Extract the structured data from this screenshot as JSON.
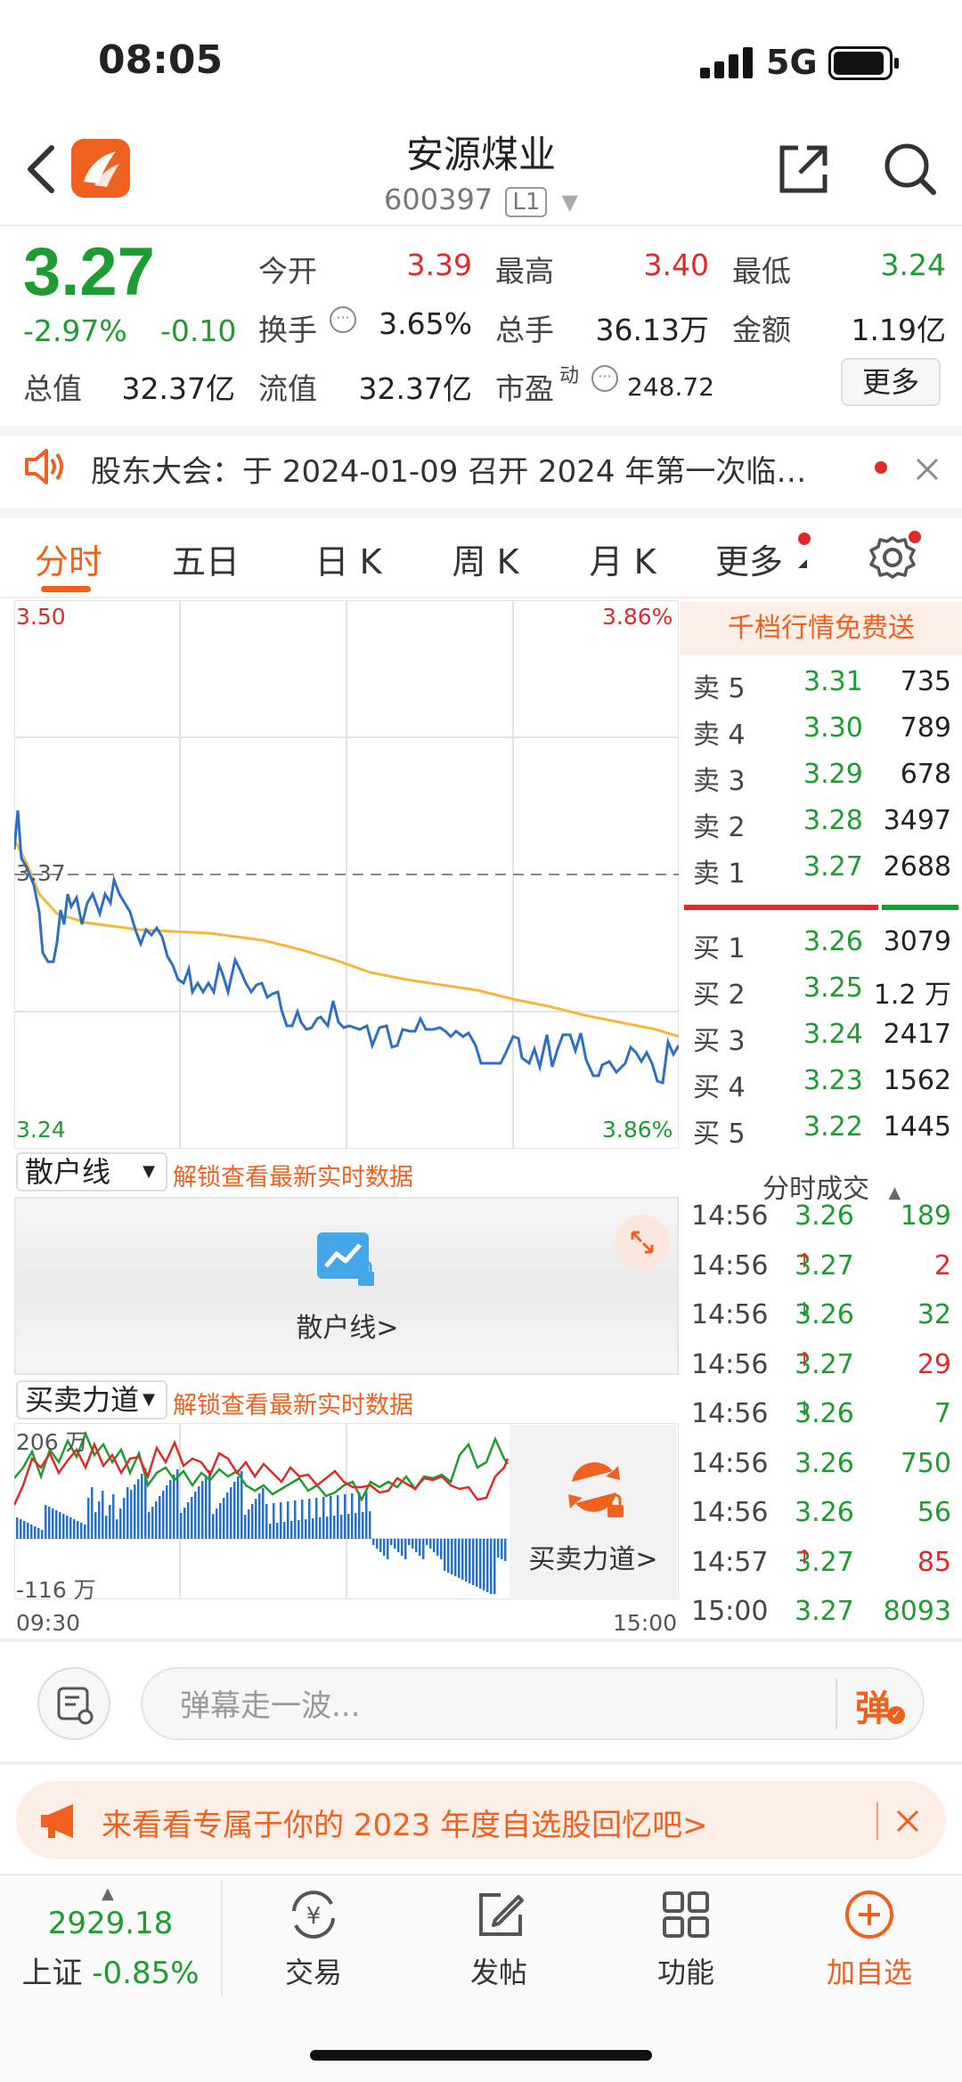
{
  "status_bar": {
    "time": "08:05",
    "network": "5G"
  },
  "header": {
    "name": "安源煤业",
    "code": "600397",
    "level": "L1"
  },
  "quote": {
    "price": "3.27",
    "change_pct": "-2.97%",
    "change": "-0.10",
    "open_label": "今开",
    "open": "3.39",
    "high_label": "最高",
    "high": "3.40",
    "low_label": "最低",
    "low": "3.24",
    "turnover_label": "换手",
    "turnover": "3.65%",
    "volume_label": "总手",
    "volume": "36.13万",
    "amount_label": "金额",
    "amount": "1.19亿",
    "mcap_label": "总值",
    "mcap": "32.37亿",
    "float_label": "流值",
    "float_cap": "32.37亿",
    "pe_label": "市盈",
    "pe_sup": "动",
    "pe": "248.72",
    "more": "更多"
  },
  "notice": {
    "text": "股东大会：于 2024-01-09 召开 2024 年第一次临…"
  },
  "tabs": [
    "分时",
    "五日",
    "日 K",
    "周 K",
    "月 K",
    "更多"
  ],
  "chart": {
    "top_price": "3.50",
    "top_pct": "3.86%",
    "bottom_price": "3.24",
    "bottom_pct": "3.86%",
    "ref_price": "3.37",
    "start_time": "09:30",
    "end_time": "15:00",
    "sub1_select": "散户线",
    "sub1_unlock": "解锁查看最新实时数据",
    "sub1_button": "散户线>",
    "sub2_select": "买卖力道",
    "sub2_unlock": "解锁查看最新实时数据",
    "sub2_button": "买卖力道>",
    "sub2_max": "206 万",
    "sub2_min": "-116 万"
  },
  "order_book": {
    "title": "千档行情免费送",
    "asks": [
      {
        "label": "卖 5",
        "price": "3.31",
        "vol": "735"
      },
      {
        "label": "卖 4",
        "price": "3.30",
        "vol": "789"
      },
      {
        "label": "卖 3",
        "price": "3.29",
        "vol": "678"
      },
      {
        "label": "卖 2",
        "price": "3.28",
        "vol": "3497"
      },
      {
        "label": "卖 1",
        "price": "3.27",
        "vol": "2688"
      }
    ],
    "bids": [
      {
        "label": "买 1",
        "price": "3.26",
        "vol": "3079"
      },
      {
        "label": "买 2",
        "price": "3.25",
        "vol": "1.2 万"
      },
      {
        "label": "买 3",
        "price": "3.24",
        "vol": "2417"
      },
      {
        "label": "买 4",
        "price": "3.23",
        "vol": "1562"
      },
      {
        "label": "买 5",
        "price": "3.22",
        "vol": "1445"
      }
    ]
  },
  "ticks": {
    "title": "分时成交",
    "rows": [
      {
        "time": "14:56",
        "price": "3.26",
        "arrow": "",
        "vol": "189",
        "color": "#1e9b31"
      },
      {
        "time": "14:56",
        "price": "3.27",
        "arrow": "↑",
        "vol": "2",
        "color": "#e02a2a"
      },
      {
        "time": "14:56",
        "price": "3.26",
        "arrow": "↓",
        "vol": "32",
        "color": "#1e9b31"
      },
      {
        "time": "14:56",
        "price": "3.27",
        "arrow": "↑",
        "vol": "29",
        "color": "#e02a2a"
      },
      {
        "time": "14:56",
        "price": "3.26",
        "arrow": "↓",
        "vol": "7",
        "color": "#1e9b31"
      },
      {
        "time": "14:56",
        "price": "3.26",
        "arrow": "",
        "vol": "750",
        "color": "#1e9b31"
      },
      {
        "time": "14:56",
        "price": "3.26",
        "arrow": "",
        "vol": "56",
        "color": "#1e9b31"
      },
      {
        "time": "14:57",
        "price": "3.27",
        "arrow": "↑",
        "vol": "85",
        "color": "#e02a2a"
      },
      {
        "time": "15:00",
        "price": "3.27",
        "arrow": "",
        "vol": "8093",
        "color": "#1e9b31"
      }
    ]
  },
  "danmu": {
    "placeholder": "弹幕走一波...",
    "button": "弹"
  },
  "promo": {
    "text": "来看看专属于你的 2023 年度自选股回忆吧>"
  },
  "bottom_nav": {
    "index_value": "2929.18",
    "index_name": "上证",
    "index_change": "-0.85%",
    "trade": "交易",
    "post": "发帖",
    "functions": "功能",
    "add_watch": "加自选"
  },
  "colors": {
    "accent": "#f0601e",
    "up": "#e02a2a",
    "down": "#1e9b31",
    "price_line": "#2f6fbf",
    "avg_line": "#f5b73b"
  },
  "icons": [
    "back-icon",
    "app-logo-icon",
    "share-icon",
    "search-icon",
    "speaker-icon",
    "close-icon",
    "settings-icon",
    "expand-icon",
    "chart-lock-icon",
    "exchange-lock-icon",
    "danmu-settings-icon",
    "megaphone-icon",
    "yen-exchange-icon",
    "edit-icon",
    "grid-icon",
    "plus-circle-icon"
  ]
}
